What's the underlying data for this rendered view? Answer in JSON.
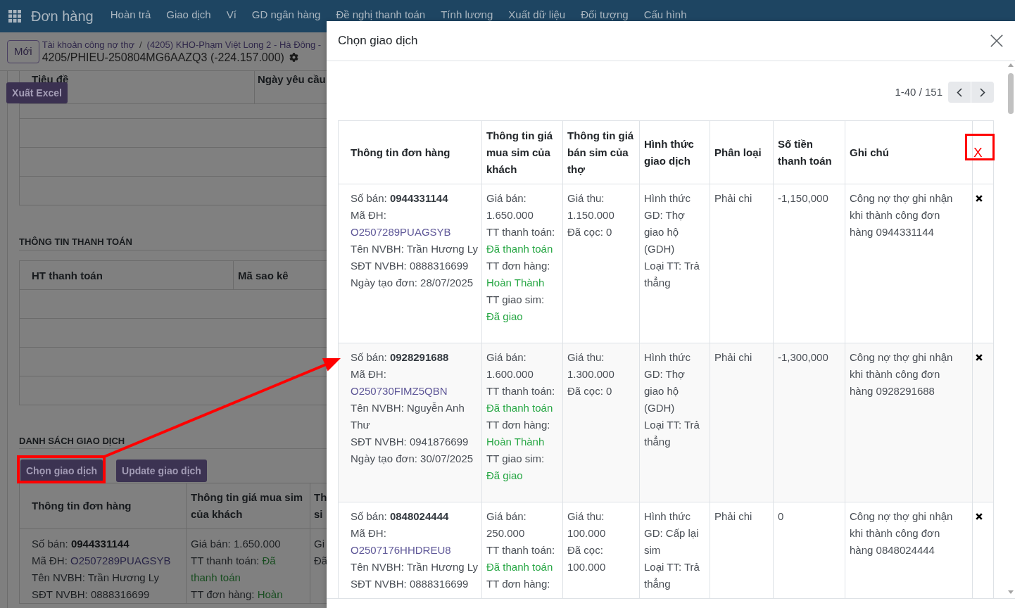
{
  "navbar": {
    "app_name": "Đơn hàng",
    "menu": [
      "Hoàn trả",
      "Giao dịch",
      "Ví",
      "GD ngân hàng",
      "Đề nghị thanh toán",
      "Tính lương",
      "Xuất dữ liệu",
      "Đối tượng",
      "Cấu hình"
    ]
  },
  "control_panel": {
    "new_button": "Mới",
    "breadcrumb": [
      "Tài khoản công nợ thợ",
      "(4205) KHO-Phạm Việt Long 2 - Hà Đông -"
    ],
    "breadcrumb_separator": "/",
    "record_title": "4205/PHIEU-250804MG6AAZQ3 (-224.157.000)"
  },
  "form": {
    "top_table": {
      "columns": [
        "Tiêu đề",
        "Ngày yêu cầu"
      ]
    },
    "export_button": "Xuất Excel",
    "payment_section": {
      "title": "THÔNG TIN THANH TOÁN",
      "columns": [
        "HT thanh toán",
        "Mã sao kê"
      ]
    },
    "transactions_section": {
      "title": "DANH SÁCH GIAO DỊCH",
      "buttons": [
        "Chọn giao dịch",
        "Update giao dịch"
      ],
      "columns": [
        "Thông tin đơn hàng",
        "Thông tin giá mua sim của khách"
      ],
      "column_3_header": [
        "Th",
        "si"
      ],
      "rows": [
        {
          "order_info": [
            {
              "label": "Số bán:",
              "value": "0944331144",
              "kind": "bold"
            },
            {
              "label": "Mã ĐH:",
              "value": "O2507289PUAGSYB",
              "kind": "link"
            },
            {
              "label": "Tên NVBH:",
              "value": "Trần Hương Ly",
              "kind": "plain"
            },
            {
              "label": "SĐT NVBH:",
              "value": "0888316699",
              "kind": "plain"
            }
          ],
          "buy_price": [
            {
              "label": "Giá bán:",
              "value": "1.650.000",
              "kind": "plain"
            },
            {
              "label": "TT thanh toán:",
              "value": "Đã thanh toán",
              "kind": "status"
            },
            {
              "label": "TT đơn hàng:",
              "value": "Hoàn",
              "kind": "status"
            }
          ],
          "column_3": [
            "Gi",
            "Đã"
          ]
        }
      ]
    }
  },
  "dialog": {
    "title": "Chọn giao dịch",
    "pager": "1-40 / 151",
    "columns": [
      "Thông tin đơn hàng",
      "Thông tin giá mua sim của khách",
      "Thông tin giá bán sim của thợ",
      "Hình thức giao dịch",
      "Phân loại",
      "Số tiền thanh toán",
      "Ghi chú",
      "X"
    ],
    "rows": [
      {
        "order_info": [
          {
            "label": "Số bán:",
            "value": "0944331144",
            "kind": "bold"
          },
          {
            "label": "Mã ĐH:",
            "value": "O2507289PUAGSYB",
            "kind": "link"
          },
          {
            "label": "Tên NVBH:",
            "value": "Trần Hương Ly",
            "kind": "plain"
          },
          {
            "label": "SĐT NVBH:",
            "value": "0888316699",
            "kind": "plain"
          },
          {
            "label": "Ngày tạo đơn:",
            "value": "28/07/2025",
            "kind": "plain"
          }
        ],
        "buy_price": [
          {
            "label": "Giá bán:",
            "value": "1.650.000",
            "kind": "plain"
          },
          {
            "label": "TT thanh toán:",
            "value": "Đã thanh toán",
            "kind": "status"
          },
          {
            "label": "TT đơn hàng:",
            "value": "Hoàn Thành",
            "kind": "status"
          },
          {
            "label": "TT giao sim:",
            "value": "Đã giao",
            "kind": "status"
          }
        ],
        "sell_price": [
          {
            "label": "Giá thu:",
            "value": "1.150.000",
            "kind": "plain"
          },
          {
            "label": "Đã cọc:",
            "value": "0",
            "kind": "plain"
          }
        ],
        "transaction_type": [
          {
            "label": "Hình thức GD:",
            "value": "Thợ giao hộ (GDH)",
            "kind": "plain"
          },
          {
            "label": "Loại TT:",
            "value": "Trả thẳng",
            "kind": "plain"
          }
        ],
        "category": "Phải chi",
        "amount": "-1,150,000",
        "note": "Công nợ thợ ghi nhận khi thành công đơn hàng 0944331144"
      },
      {
        "order_info": [
          {
            "label": "Số bán:",
            "value": "0928291688",
            "kind": "bold"
          },
          {
            "label": "Mã ĐH:",
            "value": "O250730FIMZ5QBN",
            "kind": "link"
          },
          {
            "label": "Tên NVBH:",
            "value": "Nguyễn Anh Thư",
            "kind": "plain"
          },
          {
            "label": "SĐT NVBH:",
            "value": "0941876699",
            "kind": "plain"
          },
          {
            "label": "Ngày tạo đơn:",
            "value": "30/07/2025",
            "kind": "plain"
          }
        ],
        "buy_price": [
          {
            "label": "Giá bán:",
            "value": "1.600.000",
            "kind": "plain"
          },
          {
            "label": "TT thanh toán:",
            "value": "Đã thanh toán",
            "kind": "status"
          },
          {
            "label": "TT đơn hàng:",
            "value": "Hoàn Thành",
            "kind": "status"
          },
          {
            "label": "TT giao sim:",
            "value": "Đã giao",
            "kind": "status"
          }
        ],
        "sell_price": [
          {
            "label": "Giá thu:",
            "value": "1.300.000",
            "kind": "plain"
          },
          {
            "label": "Đã cọc:",
            "value": "0",
            "kind": "plain"
          }
        ],
        "transaction_type": [
          {
            "label": "Hình thức GD:",
            "value": "Thợ giao hộ (GDH)",
            "kind": "plain"
          },
          {
            "label": "Loại TT:",
            "value": "Trả thẳng",
            "kind": "plain"
          }
        ],
        "category": "Phải chi",
        "amount": "-1,300,000",
        "note": "Công nợ thợ ghi nhận khi thành công đơn hàng 0928291688"
      },
      {
        "order_info": [
          {
            "label": "Số bán:",
            "value": "0848024444",
            "kind": "bold"
          },
          {
            "label": "Mã ĐH:",
            "value": "O2507176HHDREU8",
            "kind": "link"
          },
          {
            "label": "Tên NVBH:",
            "value": "Trần Hương Ly",
            "kind": "plain"
          },
          {
            "label": "SĐT NVBH:",
            "value": "0888316699",
            "kind": "plain"
          }
        ],
        "buy_price": [
          {
            "label": "Giá bán:",
            "value": "250.000",
            "kind": "plain"
          },
          {
            "label": "TT thanh toán:",
            "value": "Đã thanh toán",
            "kind": "status"
          },
          {
            "label": "TT đơn hàng:",
            "kind": "plain"
          }
        ],
        "sell_price": [
          {
            "label": "Giá thu:",
            "value": "100.000",
            "kind": "plain"
          },
          {
            "label": "Đã cọc:",
            "value": "100.000",
            "kind": "plain"
          }
        ],
        "transaction_type": [
          {
            "label": "Hình thức GD:",
            "value": "Cấp lại sim",
            "kind": "plain"
          },
          {
            "label": "Loại TT:",
            "value": "Trả thẳng",
            "kind": "plain"
          }
        ],
        "category": "Phải chi",
        "amount": "0",
        "note": "Công nợ thợ ghi nhận khi thành công đơn hàng 0848024444"
      }
    ]
  }
}
